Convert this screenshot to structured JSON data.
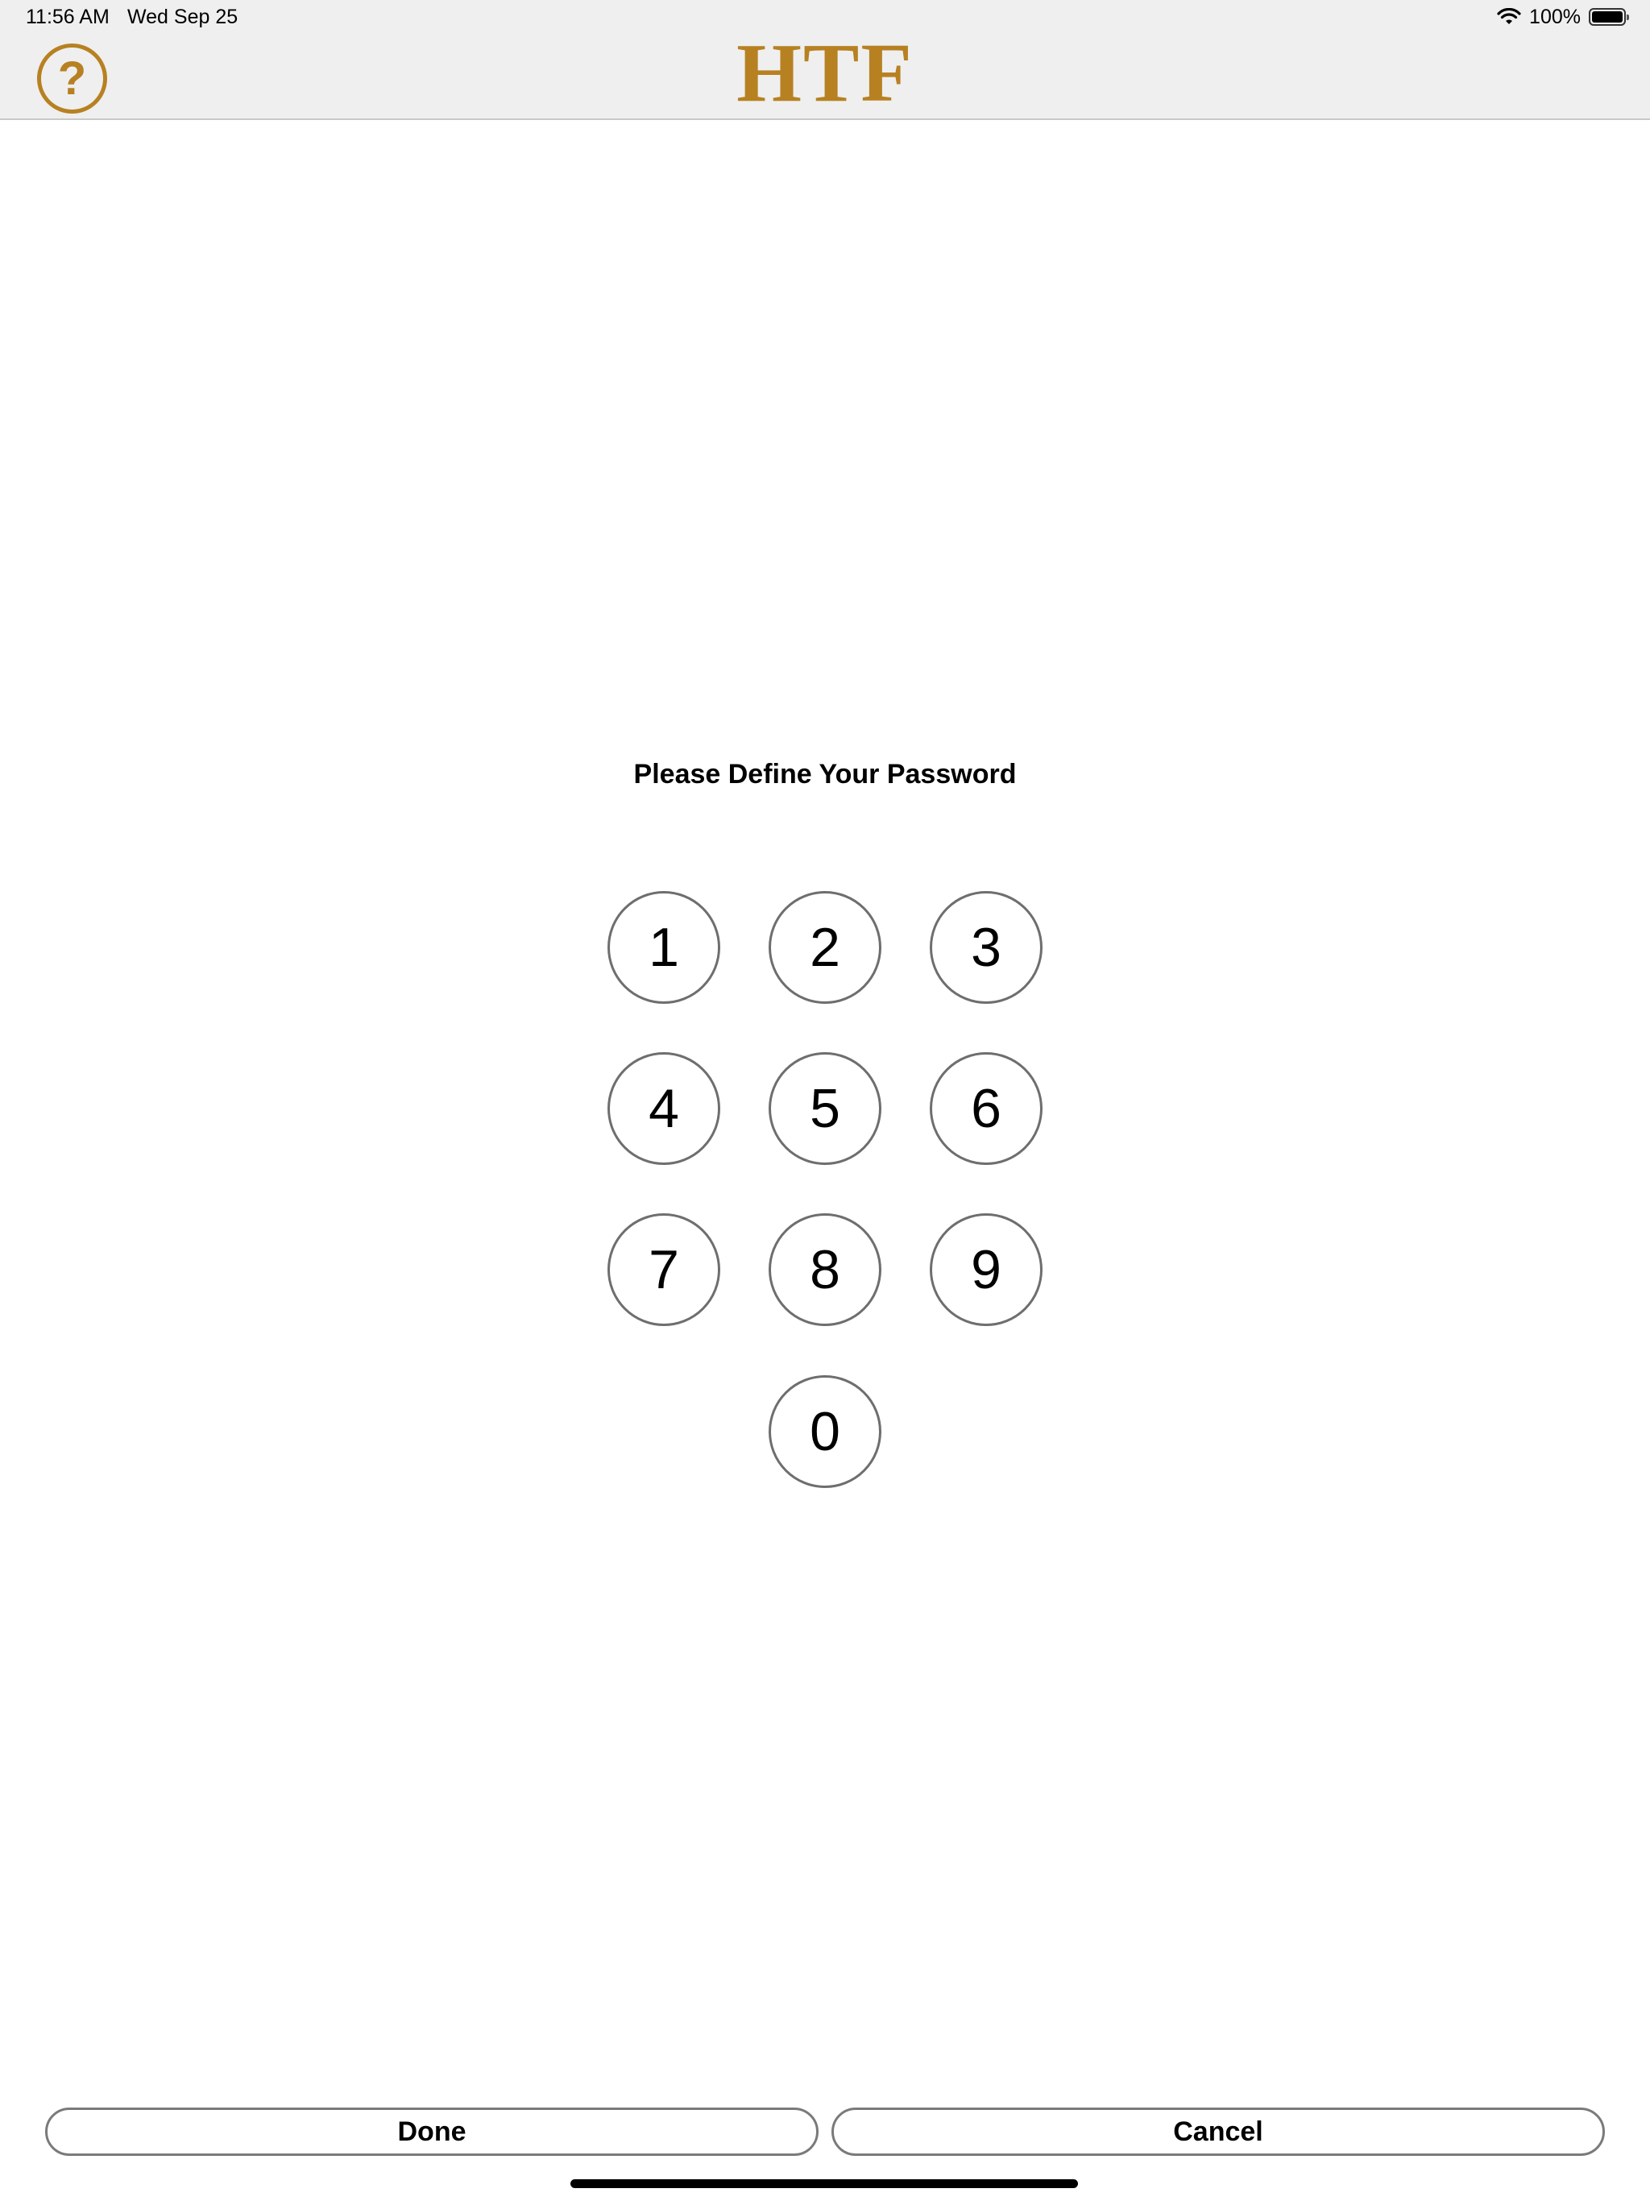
{
  "status_bar": {
    "time": "11:56 AM",
    "date": "Wed Sep 25",
    "battery_percent": "100%",
    "wifi_icon": "wifi-icon",
    "battery_icon": "battery-icon"
  },
  "nav_bar": {
    "help_icon": "question-mark-circle-icon",
    "help_label": "?",
    "logo_text": "HTF",
    "accent_color": "#b78122"
  },
  "prompt": "Please Define Your Password",
  "keypad": {
    "k1": "1",
    "k2": "2",
    "k3": "3",
    "k4": "4",
    "k5": "5",
    "k6": "6",
    "k7": "7",
    "k8": "8",
    "k9": "9",
    "k0": "0"
  },
  "actions": {
    "done_label": "Done",
    "cancel_label": "Cancel"
  }
}
